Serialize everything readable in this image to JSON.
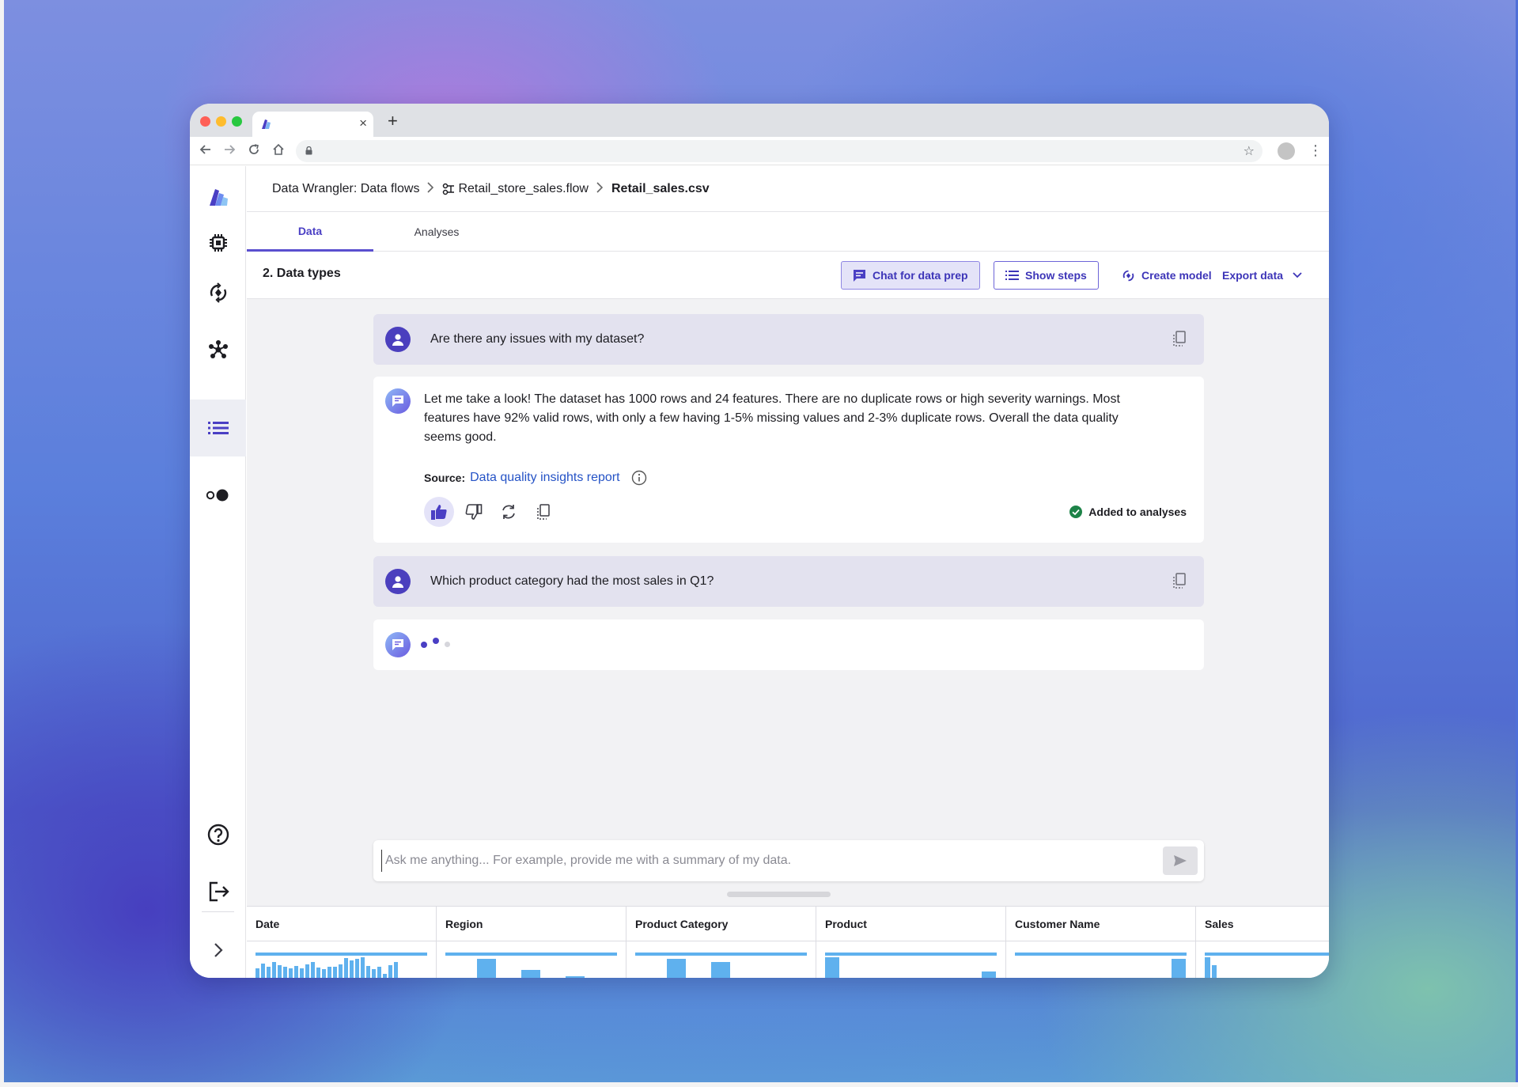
{
  "browser": {
    "tab_close": "×",
    "new_tab": "+"
  },
  "breadcrumb": {
    "root": "Data Wrangler: Data flows",
    "flow": "Retail_store_sales.flow",
    "file": "Retail_sales.csv"
  },
  "tabs": [
    "Data",
    "Analyses"
  ],
  "toolbar": {
    "step_title": "2. Data types",
    "chat_button": "Chat for data prep",
    "steps_button": "Show steps",
    "create_model": "Create model",
    "export_data": "Export data"
  },
  "chat": {
    "messages": [
      {
        "role": "user",
        "text": "Are there any issues with my dataset?"
      },
      {
        "role": "assistant",
        "lines": [
          "Let me take a look! The dataset has 1000 rows and 24 features. There are no duplicate rows or high severity warnings. Most",
          "features have 92% valid rows, with only a few having 1-5% missing values and 2-3% duplicate rows. Overall the data quality",
          "seems good."
        ],
        "source_label": "Source:",
        "source_link": "Data quality insights report",
        "status": "Added to analyses",
        "liked": true
      },
      {
        "role": "user",
        "text": "Which product category had the most sales in Q1?"
      },
      {
        "role": "assistant",
        "loading": true
      }
    ],
    "input_placeholder": "Ask me anything... For example, provide me with a summary of my data.",
    "input_value": ""
  },
  "table": {
    "columns": [
      "Date",
      "Region",
      "Product Category",
      "Product",
      "Customer Name",
      "Sales"
    ]
  },
  "colors": {
    "accent": "#4b3fbe",
    "link": "#2553c6",
    "histogram": "#5fb1ee",
    "success": "#1d8348"
  }
}
